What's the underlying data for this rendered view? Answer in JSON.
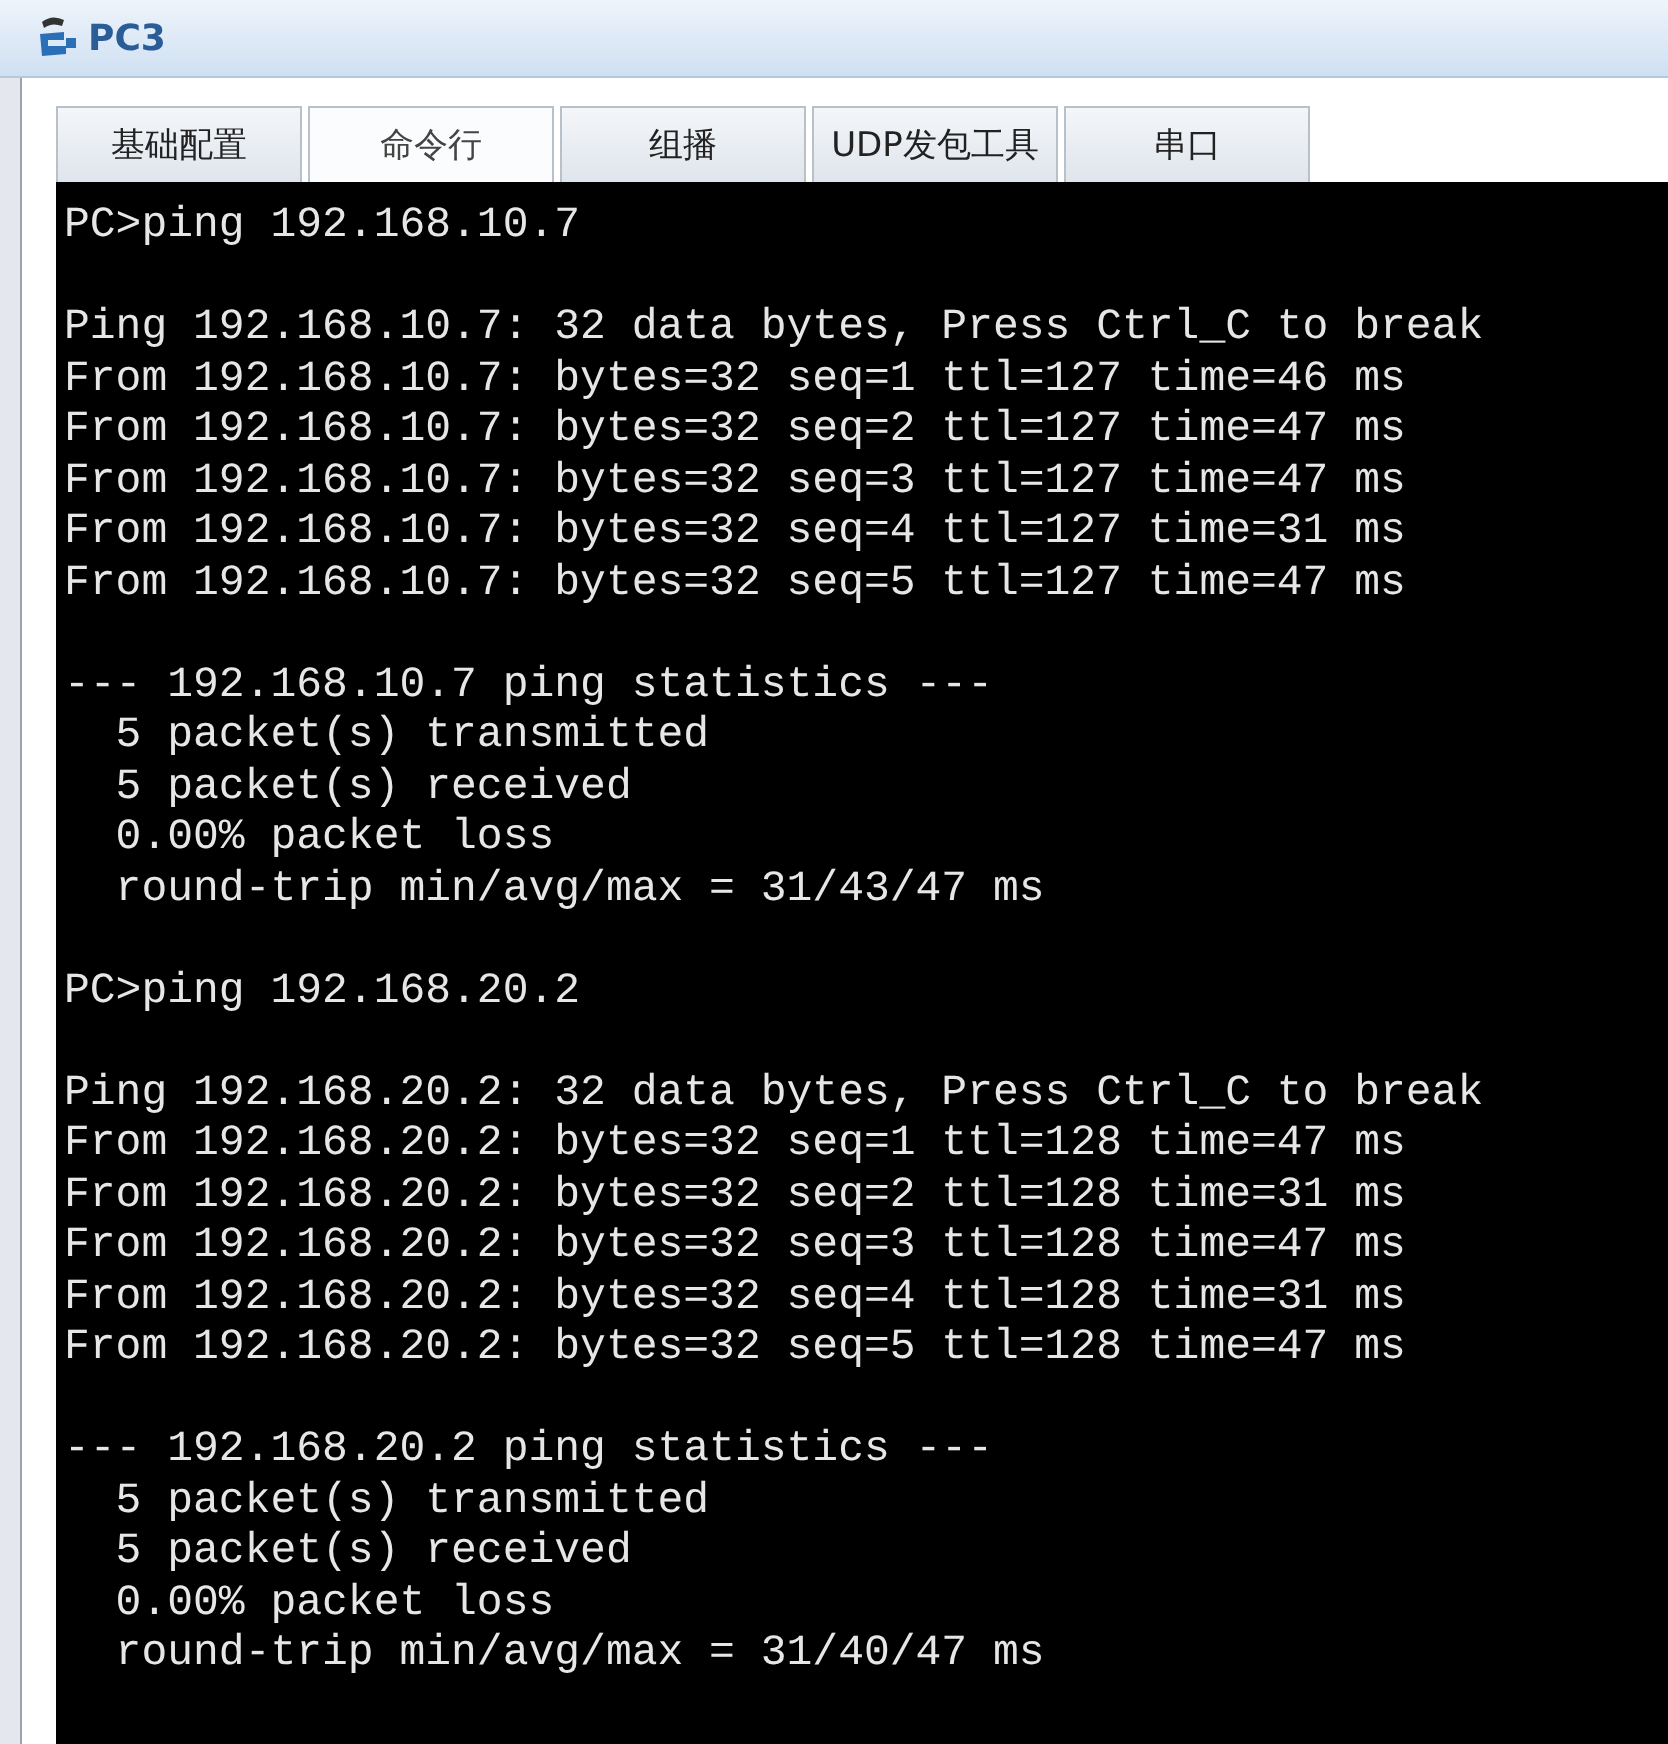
{
  "window": {
    "title": "PC3"
  },
  "tabs": [
    {
      "label": "基础配置",
      "selected": false
    },
    {
      "label": "命令行",
      "selected": true
    },
    {
      "label": "组播",
      "selected": false
    },
    {
      "label": "UDP发包工具",
      "selected": false
    },
    {
      "label": "串口",
      "selected": false
    }
  ],
  "terminal": {
    "blocks": [
      [
        "PC>ping 192.168.10.7"
      ],
      [
        "Ping 192.168.10.7: 32 data bytes, Press Ctrl_C to break",
        "From 192.168.10.7: bytes=32 seq=1 ttl=127 time=46 ms",
        "From 192.168.10.7: bytes=32 seq=2 ttl=127 time=47 ms",
        "From 192.168.10.7: bytes=32 seq=3 ttl=127 time=47 ms",
        "From 192.168.10.7: bytes=32 seq=4 ttl=127 time=31 ms",
        "From 192.168.10.7: bytes=32 seq=5 ttl=127 time=47 ms"
      ],
      [
        "--- 192.168.10.7 ping statistics ---",
        "  5 packet(s) transmitted",
        "  5 packet(s) received",
        "  0.00% packet loss",
        "  round-trip min/avg/max = 31/43/47 ms"
      ],
      [
        "PC>ping 192.168.20.2"
      ],
      [
        "Ping 192.168.20.2: 32 data bytes, Press Ctrl_C to break",
        "From 192.168.20.2: bytes=32 seq=1 ttl=128 time=47 ms",
        "From 192.168.20.2: bytes=32 seq=2 ttl=128 time=31 ms",
        "From 192.168.20.2: bytes=32 seq=3 ttl=128 time=47 ms",
        "From 192.168.20.2: bytes=32 seq=4 ttl=128 time=31 ms",
        "From 192.168.20.2: bytes=32 seq=5 ttl=128 time=47 ms"
      ],
      [
        "--- 192.168.20.2 ping statistics ---",
        "  5 packet(s) transmitted",
        "  5 packet(s) received",
        "  0.00% packet loss",
        "  round-trip min/avg/max = 31/40/47 ms"
      ]
    ]
  }
}
